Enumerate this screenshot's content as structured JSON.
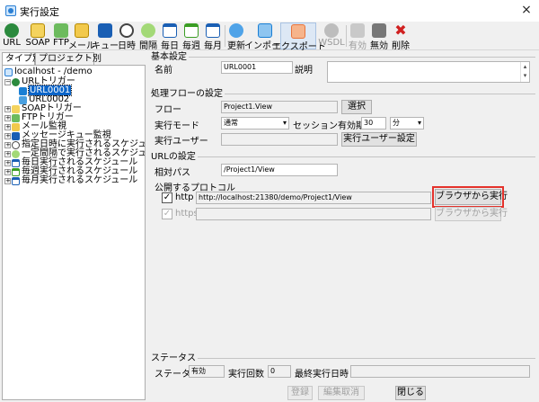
{
  "window": {
    "title": "実行設定",
    "close_glyph": "×"
  },
  "toolbar": {
    "items": [
      {
        "label": "URL",
        "icon": "url-globe-icon",
        "color": "#2b8a3e"
      },
      {
        "label": "SOAP",
        "icon": "soap-envelope-icon",
        "color": "#d9a300"
      },
      {
        "label": "FTP",
        "icon": "ftp-icon",
        "color": "#2b8a3e"
      },
      {
        "label": "メール",
        "icon": "mail-icon",
        "color": "#d9a300"
      },
      {
        "label": "キュー",
        "icon": "queue-icon",
        "color": "#1a5fb4"
      },
      {
        "label": "日時",
        "icon": "clock-icon",
        "color": "#555555"
      },
      {
        "label": "間隔",
        "icon": "interval-icon",
        "color": "#2b8a3e"
      },
      {
        "label": "毎日",
        "icon": "calendar-day-icon",
        "color": "#1a5fb4"
      },
      {
        "label": "毎週",
        "icon": "calendar-week-icon",
        "color": "#3a9d23"
      },
      {
        "label": "毎月",
        "icon": "calendar-month-icon",
        "color": "#1a5fb4"
      },
      {
        "label": "更新",
        "icon": "refresh-icon",
        "color": "#1a7fd4"
      },
      {
        "label": "インポート",
        "icon": "import-icon",
        "color": "#1a7fd4"
      },
      {
        "label": "エクスポート",
        "icon": "export-icon",
        "color": "#e8733a"
      },
      {
        "label": "WSDL",
        "icon": "wsdl-icon",
        "color": "#9a9a9a"
      },
      {
        "label": "有効",
        "icon": "enable-icon",
        "color": "#9a9a9a"
      },
      {
        "label": "無効",
        "icon": "disable-icon",
        "color": "#555555"
      },
      {
        "label": "削除",
        "icon": "delete-x-icon",
        "color": "#d02020"
      }
    ]
  },
  "left": {
    "tabs": [
      "タイプ別",
      "プロジェクト別"
    ],
    "tree": [
      {
        "label": "localhost - /demo",
        "icon": "server-icon"
      },
      {
        "label": "URLトリガー",
        "icon": "url-globe-icon"
      },
      {
        "label": "URL0001",
        "icon": "url-item-icon"
      },
      {
        "label": "URL0002",
        "icon": "url-item-icon"
      },
      {
        "label": "SOAPトリガー",
        "icon": "soap-envelope-icon"
      },
      {
        "label": "FTPトリガー",
        "icon": "ftp-icon"
      },
      {
        "label": "メール監視",
        "icon": "mail-icon"
      },
      {
        "label": "メッセージキュー監視",
        "icon": "queue-icon"
      },
      {
        "label": "指定日時に実行されるスケジュール",
        "icon": "clock-icon"
      },
      {
        "label": "一定間隔で実行されるスケジュール",
        "icon": "interval-icon"
      },
      {
        "label": "毎日実行されるスケジュール",
        "icon": "calendar-day-icon"
      },
      {
        "label": "毎週実行されるスケジュール",
        "icon": "calendar-week-icon"
      },
      {
        "label": "毎月実行されるスケジュール",
        "icon": "calendar-month-icon"
      }
    ]
  },
  "basic": {
    "title": "基本設定",
    "name_label": "名前",
    "name_value": "URL0001",
    "desc_label": "説明",
    "desc_value": ""
  },
  "flow": {
    "title": "処理フローの設定",
    "flow_label": "フロー",
    "flow_value": "Project1.View",
    "select_button": "選択",
    "mode_label": "実行モード",
    "mode_value": "通常",
    "session_label": "セッション有効期間",
    "session_value": "30",
    "session_unit": "分",
    "user_label": "実行ユーザー",
    "user_value": "",
    "user_button": "実行ユーザー設定"
  },
  "url": {
    "title": "URLの設定",
    "path_label": "相対パス",
    "path_value": "/Project1/View",
    "protocol_label": "公開するプロトコル",
    "http_label": "http",
    "http_url": "http://localhost:21380/demo/Project1/View",
    "http_button": "ブラウザから実行",
    "https_label": "https",
    "https_url": "",
    "https_button": "ブラウザから実行",
    "check_glyph": "✓"
  },
  "status": {
    "title": "ステータス",
    "status_label": "ステータス",
    "status_value": "有効",
    "count_label": "実行回数",
    "count_value": "0",
    "last_label": "最終実行日時",
    "last_value": ""
  },
  "footer": {
    "register": "登録",
    "cancel": "編集取消",
    "close": "閉じる"
  },
  "colors": {
    "selection": "#0a64c8",
    "highlight": "#e4322b"
  }
}
